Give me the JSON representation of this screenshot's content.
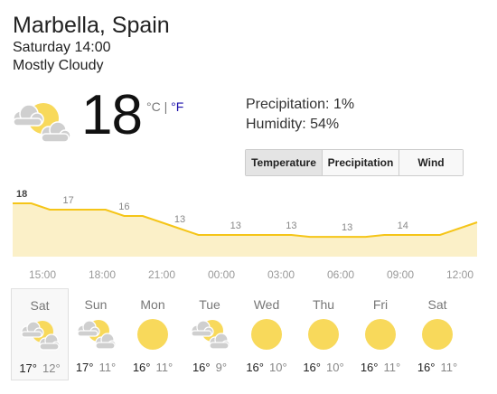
{
  "location": "Marbella, Spain",
  "datetime": "Saturday 14:00",
  "condition": "Mostly Cloudy",
  "current": {
    "temperature": "18",
    "unit_c": "°C",
    "unit_sep": "|",
    "unit_f": "°F",
    "icon": "partly-cloudy-icon"
  },
  "details": {
    "precipitation": "Precipitation: 1%",
    "humidity": "Humidity: 54%"
  },
  "tabs": [
    {
      "label": "Temperature",
      "active": true
    },
    {
      "label": "Precipitation",
      "active": false
    },
    {
      "label": "Wind",
      "active": false
    }
  ],
  "colors": {
    "chart_line": "#F5C518",
    "chart_fill": "#FBF0C8",
    "sun": "#F8D95B",
    "cloud": "#CFCFCF"
  },
  "chart_data": {
    "type": "area",
    "x": [
      0,
      1,
      2,
      3,
      4,
      5,
      6,
      7,
      8,
      9,
      10,
      11,
      12,
      13,
      14,
      15,
      16,
      17,
      18,
      19,
      20,
      21,
      22,
      23,
      24
    ],
    "values": [
      18,
      18,
      17,
      17,
      17,
      17,
      16,
      16,
      15,
      14,
      13,
      13,
      13,
      13,
      13,
      13,
      12.7,
      12.7,
      12.7,
      12.7,
      13,
      13,
      13,
      13,
      14,
      15
    ],
    "point_labels": [
      {
        "index": 0,
        "text": "18"
      },
      {
        "index": 3,
        "text": "17"
      },
      {
        "index": 6,
        "text": "16"
      },
      {
        "index": 9,
        "text": "13"
      },
      {
        "index": 12,
        "text": "13"
      },
      {
        "index": 15,
        "text": "13"
      },
      {
        "index": 18,
        "text": "13"
      },
      {
        "index": 21,
        "text": "14"
      }
    ],
    "x_tick_labels": [
      "15:00",
      "18:00",
      "21:00",
      "00:00",
      "03:00",
      "06:00",
      "09:00",
      "12:00"
    ]
  },
  "forecast": [
    {
      "day": "Sat",
      "icon": "partly-cloudy-icon",
      "high": "17°",
      "low": "12°",
      "selected": true
    },
    {
      "day": "Sun",
      "icon": "partly-cloudy-icon",
      "high": "17°",
      "low": "11°",
      "selected": false
    },
    {
      "day": "Mon",
      "icon": "sun-icon",
      "high": "16°",
      "low": "11°",
      "selected": false
    },
    {
      "day": "Tue",
      "icon": "partly-cloudy-icon",
      "high": "16°",
      "low": "9°",
      "selected": false
    },
    {
      "day": "Wed",
      "icon": "sun-icon",
      "high": "16°",
      "low": "10°",
      "selected": false
    },
    {
      "day": "Thu",
      "icon": "sun-icon",
      "high": "16°",
      "low": "10°",
      "selected": false
    },
    {
      "day": "Fri",
      "icon": "sun-icon",
      "high": "16°",
      "low": "11°",
      "selected": false
    },
    {
      "day": "Sat",
      "icon": "sun-icon",
      "high": "16°",
      "low": "11°",
      "selected": false
    }
  ]
}
